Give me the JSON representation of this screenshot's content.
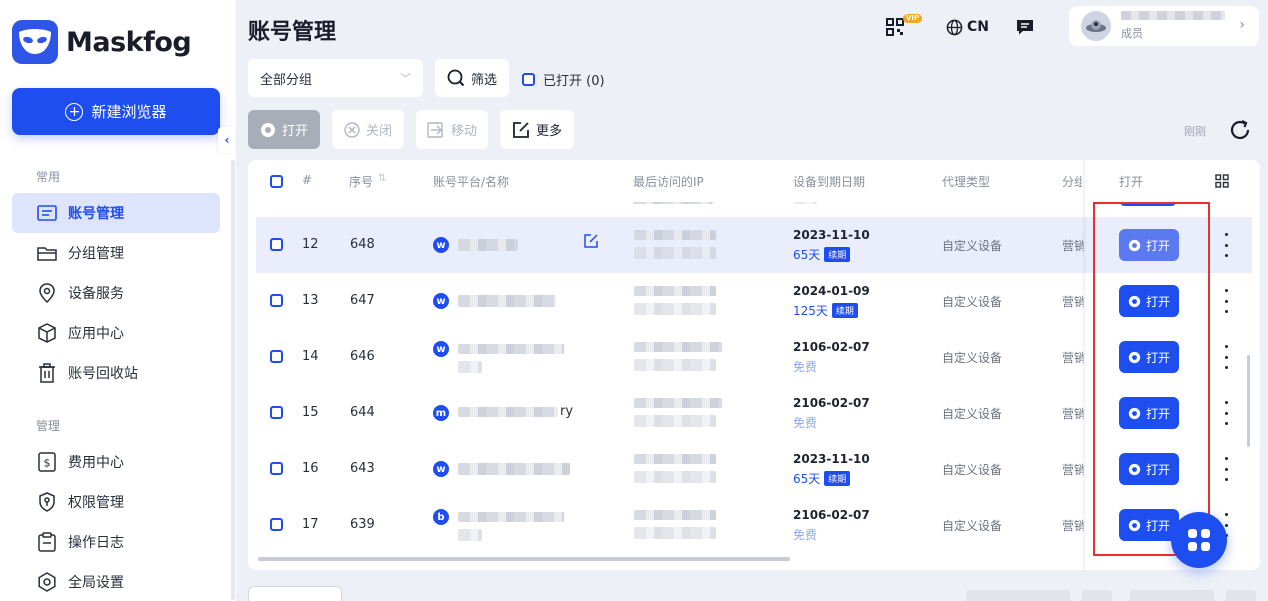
{
  "brand": {
    "name": "Maskfog"
  },
  "sidebar": {
    "new_browser": "新建浏览器",
    "section_common": "常用",
    "section_manage": "管理",
    "items": [
      {
        "label": "账号管理",
        "icon": "account-list-icon",
        "active": true
      },
      {
        "label": "分组管理",
        "icon": "folder-icon"
      },
      {
        "label": "设备服务",
        "icon": "location-pin-icon"
      },
      {
        "label": "应用中心",
        "icon": "cube-icon"
      },
      {
        "label": "账号回收站",
        "icon": "trash-icon"
      },
      {
        "label": "费用中心",
        "icon": "dollar-icon"
      },
      {
        "label": "权限管理",
        "icon": "shield-key-icon"
      },
      {
        "label": "操作日志",
        "icon": "clipboard-icon"
      },
      {
        "label": "全局设置",
        "icon": "gear-icon"
      }
    ]
  },
  "header": {
    "title": "账号管理",
    "vip": "VIP",
    "language": "CN",
    "user_role": "成员"
  },
  "toolbar": {
    "group_select": "全部分组",
    "filter": "筛选",
    "opened": "已打开 (0)",
    "open": "打开",
    "close": "关闭",
    "move": "移动",
    "more": "更多",
    "refresh_time": "刚刚"
  },
  "table": {
    "columns": [
      "#",
      "序号",
      "账号平台/名称",
      "最后访问的IP",
      "设备到期日期",
      "代理类型",
      "分组",
      "打开"
    ],
    "rows": [
      {
        "index": "12",
        "seq": "648",
        "platform": "w",
        "name_tail": "",
        "date": "2023-11-10",
        "days": "65天",
        "renew": "续期",
        "proxy": "自定义设备",
        "group": "营销",
        "open": "打开",
        "highlight": true
      },
      {
        "index": "13",
        "seq": "647",
        "platform": "w",
        "name_tail": "",
        "date": "2024-01-09",
        "days": "125天",
        "renew": "续期",
        "proxy": "自定义设备",
        "group": "营销",
        "open": "打开"
      },
      {
        "index": "14",
        "seq": "646",
        "platform": "w",
        "name_tail": "",
        "date": "2106-02-07",
        "days": "免费",
        "renew": "",
        "proxy": "自定义设备",
        "group": "营销",
        "open": "打开"
      },
      {
        "index": "15",
        "seq": "644",
        "platform": "m",
        "name_tail": "ry",
        "date": "2106-02-07",
        "days": "免费",
        "renew": "",
        "proxy": "自定义设备",
        "group": "营销",
        "open": "打开"
      },
      {
        "index": "16",
        "seq": "643",
        "platform": "w",
        "name_tail": "",
        "date": "2023-11-10",
        "days": "65天",
        "renew": "续期",
        "proxy": "自定义设备",
        "group": "营销",
        "open": "打开"
      },
      {
        "index": "17",
        "seq": "639",
        "platform": "b",
        "name_tail": "",
        "date": "2106-02-07",
        "days": "免费",
        "renew": "",
        "proxy": "自定义设备",
        "group": "营销",
        "open": "打开"
      }
    ]
  },
  "colors": {
    "primary": "#1f4ef0",
    "annotation": "#e8302c"
  }
}
